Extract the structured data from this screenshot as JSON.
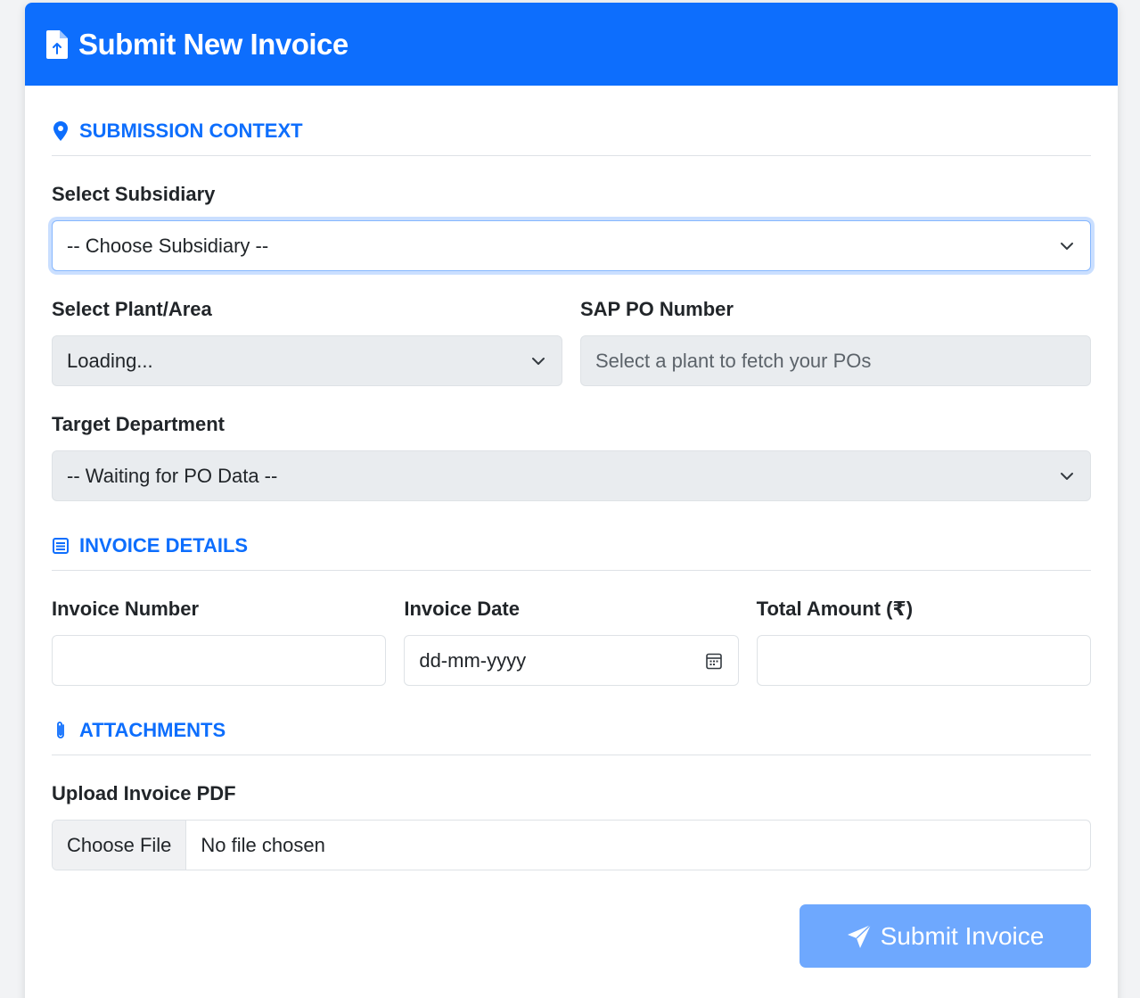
{
  "header": {
    "title": "Submit New Invoice",
    "icon": "file-upload-icon"
  },
  "colors": {
    "primary": "#0d6efd",
    "button": "#6ea8fe",
    "disabled_bg": "#e9ecef"
  },
  "sections": {
    "context": {
      "title": "SUBMISSION CONTEXT",
      "icon": "map-pin-icon"
    },
    "invoice": {
      "title": "INVOICE DETAILS",
      "icon": "list-icon"
    },
    "attachments": {
      "title": "ATTACHMENTS",
      "icon": "paperclip-icon"
    }
  },
  "fields": {
    "subsidiary": {
      "label": "Select Subsidiary",
      "value": "-- Choose Subsidiary --"
    },
    "plant": {
      "label": "Select Plant/Area",
      "value": "Loading..."
    },
    "po_number": {
      "label": "SAP PO Number",
      "placeholder": "Select a plant to fetch your POs"
    },
    "department": {
      "label": "Target Department",
      "value": "-- Waiting for PO Data --"
    },
    "invoice_number": {
      "label": "Invoice Number",
      "value": ""
    },
    "invoice_date": {
      "label": "Invoice Date",
      "placeholder": "dd-mm-yyyy"
    },
    "total_amount": {
      "label": "Total Amount (₹)",
      "value": ""
    },
    "upload": {
      "label": "Upload Invoice PDF",
      "button": "Choose File",
      "status": "No file chosen"
    }
  },
  "submit": {
    "label": "Submit Invoice",
    "icon": "send-icon"
  }
}
